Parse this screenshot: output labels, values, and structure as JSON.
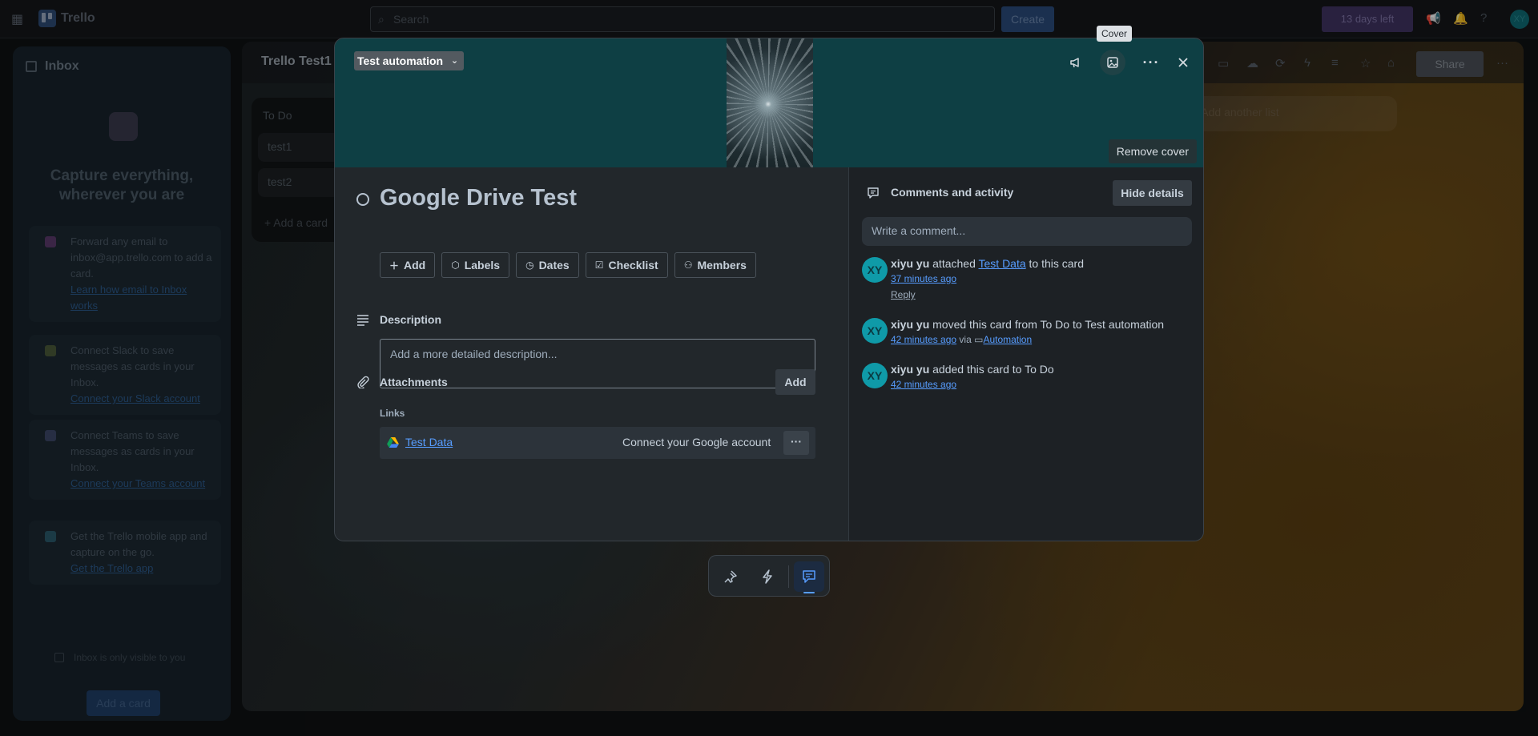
{
  "header": {
    "app_name": "Trello",
    "search_placeholder": "Search",
    "create_label": "Create",
    "trial_label": "13 days left",
    "avatar_initials": "XY"
  },
  "inbox": {
    "title": "Inbox",
    "headline": "Capture everything, wherever you are",
    "tips": [
      {
        "text": "Forward any email to inbox@app.trello.com to add a card.",
        "link": "Learn how email to Inbox works"
      },
      {
        "text": "Connect Slack to save messages as cards in your Inbox.",
        "link": "Connect your Slack account"
      },
      {
        "text": "Connect Teams to save messages as cards in your Inbox.",
        "link": "Connect your Teams account"
      },
      {
        "text": "Get the Trello mobile app and capture on the go.",
        "link": "Get the Trello app"
      }
    ],
    "visibility_note": "Inbox is only visible to you",
    "add_card_label": "Add a card"
  },
  "board": {
    "title": "Trello Test1",
    "share_label": "Share",
    "list": {
      "title": "To Do",
      "cards": [
        "test1",
        "test2"
      ],
      "add_label": "Add a card"
    },
    "add_list_label": "Add another list"
  },
  "modal": {
    "list_button": "Test automation",
    "tooltip": "Cover",
    "remove_cover": "Remove cover",
    "title": "Google Drive Test",
    "actions": [
      {
        "label": "Add",
        "icon": "plus-icon"
      },
      {
        "label": "Labels",
        "icon": "tag-icon"
      },
      {
        "label": "Dates",
        "icon": "clock-icon"
      },
      {
        "label": "Checklist",
        "icon": "checkbox-icon"
      },
      {
        "label": "Members",
        "icon": "user-icon"
      }
    ],
    "description": {
      "title": "Description",
      "placeholder": "Add a more detailed description..."
    },
    "attachments": {
      "title": "Attachments",
      "add_label": "Add",
      "links_label": "Links",
      "link_name": "Test Data",
      "connect_label": "Connect your Google account"
    },
    "activity": {
      "title": "Comments and activity",
      "hide_details": "Hide details",
      "comment_placeholder": "Write a comment...",
      "items": [
        {
          "initials": "XY",
          "user": "xiyu yu",
          "action": "attached",
          "link": "Test Data",
          "suffix": "to this card",
          "time": "37 minutes ago",
          "reply": "Reply"
        },
        {
          "initials": "XY",
          "user": "xiyu yu",
          "action": "moved this card from To Do to Test automation",
          "time": "42 minutes ago",
          "via": "via",
          "via_link": "Automation"
        },
        {
          "initials": "XY",
          "user": "xiyu yu",
          "action": "added this card to To Do",
          "time": "42 minutes ago"
        }
      ]
    }
  },
  "colors": {
    "accent_link": "#579dff",
    "avatar": "#0f9aa8",
    "cover": "#0e3f44",
    "modal_bg": "#22272b"
  }
}
